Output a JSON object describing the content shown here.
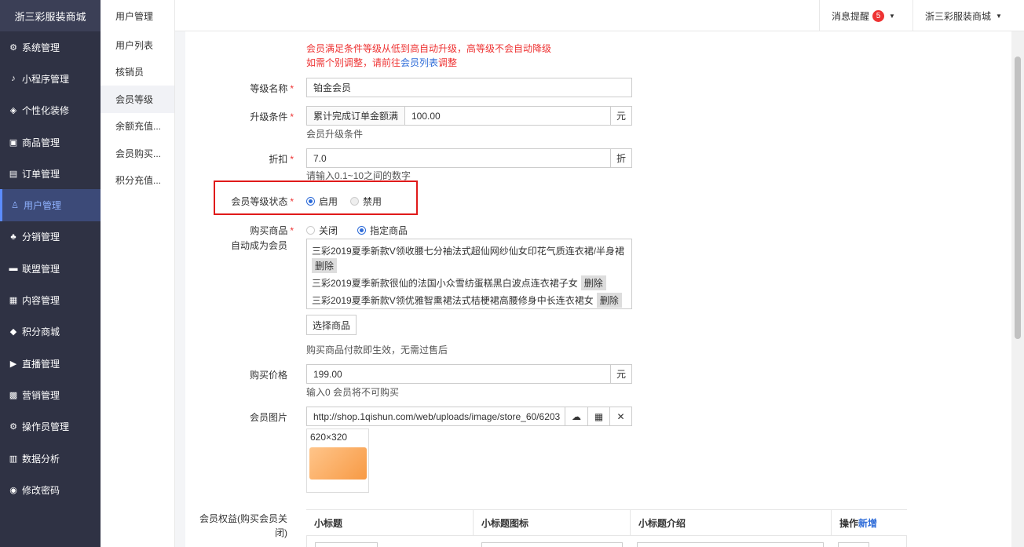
{
  "sidebar": {
    "brand": "浙三彩服装商城",
    "items": [
      {
        "label": "系统管理",
        "icon": "⚙"
      },
      {
        "label": "小程序管理",
        "icon": "♪"
      },
      {
        "label": "个性化装修",
        "icon": "◈"
      },
      {
        "label": "商品管理",
        "icon": "▣"
      },
      {
        "label": "订单管理",
        "icon": "▤"
      },
      {
        "label": "用户管理",
        "icon": "♙"
      },
      {
        "label": "分销管理",
        "icon": "♣"
      },
      {
        "label": "联盟管理",
        "icon": "▬"
      },
      {
        "label": "内容管理",
        "icon": "▦"
      },
      {
        "label": "积分商城",
        "icon": "◆"
      },
      {
        "label": "直播管理",
        "icon": "▶"
      },
      {
        "label": "营销管理",
        "icon": "▩"
      },
      {
        "label": "操作员管理",
        "icon": "⚙"
      },
      {
        "label": "数据分析",
        "icon": "▥"
      },
      {
        "label": "修改密码",
        "icon": "◉"
      }
    ],
    "active_index": 5
  },
  "subnav": {
    "title": "用户管理",
    "items": [
      "用户列表",
      "核销员",
      "会员等级",
      "余额充值...",
      "会员购买...",
      "积分充值..."
    ],
    "active_index": 2
  },
  "topbar": {
    "messages_label": "消息提醒",
    "messages_count": "5",
    "store_label": "浙三彩服装商城"
  },
  "form": {
    "notice_line1": "会员满足条件等级从低到高自动升级，高等级不会自动降级",
    "notice_line2_prefix": "如需个别调整，请前往",
    "notice_line2_link": "会员列表",
    "notice_line2_suffix": "调整",
    "level_name_label": "等级名称",
    "level_name_value": "铂金会员",
    "upgrade_label": "升级条件",
    "upgrade_prefix": "累计完成订单金额满",
    "upgrade_value": "100.00",
    "upgrade_unit": "元",
    "upgrade_help": "会员升级条件",
    "discount_label": "折扣",
    "discount_value": "7.0",
    "discount_unit": "折",
    "discount_help": "请输入0.1~10之间的数字",
    "status_label": "会员等级状态",
    "status_on": "启用",
    "status_off": "禁用",
    "buy_label_line1": "购买商品",
    "buy_label_line2": "自动成为会员",
    "buy_off": "关闭",
    "buy_specified": "指定商品",
    "goods": [
      "三彩2019夏季新款V领收腰七分袖法式超仙网纱仙女印花气质连衣裙/半身裙",
      "三彩2019夏季新款很仙的法国小众雪纺蛋糕黑白波点连衣裙子女",
      "三彩2019夏季新款V领优雅智熏裙法式桔梗裙高腰修身中长连衣裙女"
    ],
    "delete_label": "删除",
    "select_goods_button": "选择商品",
    "buy_help": "购买商品付款即生效，无需过售后",
    "price_label": "购买价格",
    "price_value": "199.00",
    "price_unit": "元",
    "price_help": "输入0 会员将不可购买",
    "image_label": "会员图片",
    "image_url": "http://shop.1qishun.com/web/uploads/image/store_60/6203",
    "image_size": "620×320",
    "benefits_label_line1": "会员权益(购买会员关",
    "benefits_label_line2": "闭)",
    "table_headers": {
      "title": "小标题",
      "icon": "小标题图标",
      "intro": "小标题介绍",
      "ops_prefix": "操作",
      "ops_add": "新增"
    }
  },
  "colors": {
    "sidebar_bg": "#2f3244",
    "highlight_box": "#e01a1a",
    "accent": "#2d6bd8",
    "required": "#e33"
  }
}
